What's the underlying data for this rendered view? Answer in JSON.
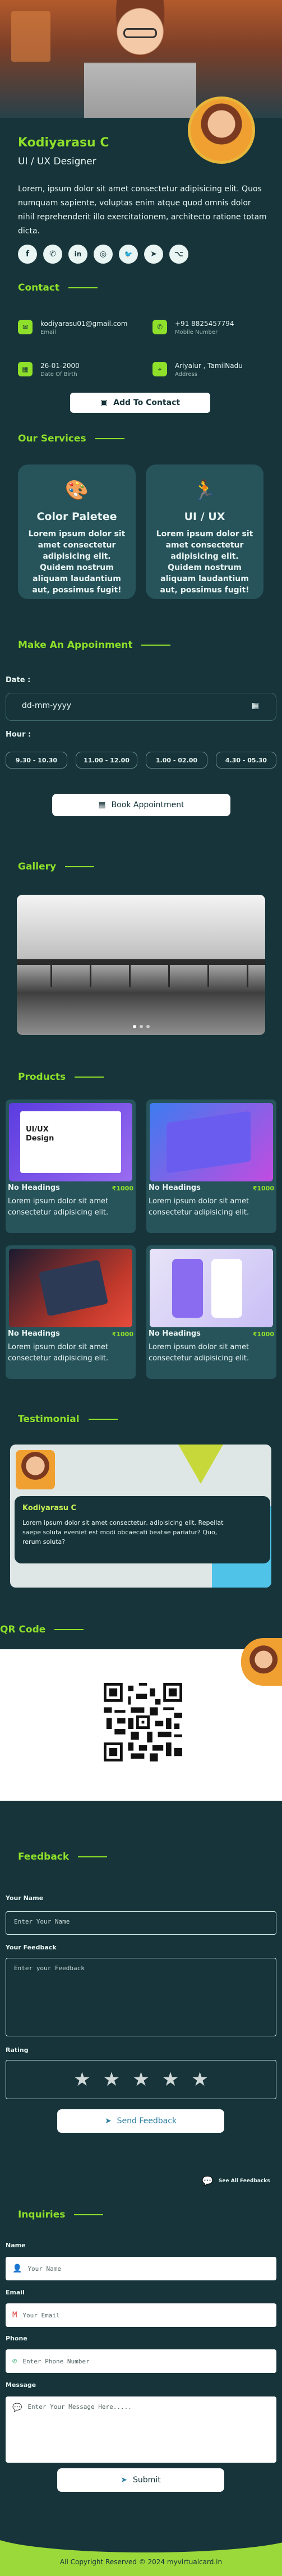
{
  "profile": {
    "name": "Kodiyarasu C",
    "role": "UI / UX Designer",
    "bio": "Lorem, ipsum dolor sit amet consectetur adipisicing elit. Quos numquam sapiente, voluptas enim atque quod omnis dolor nihil reprehenderit illo exercitationem, architecto ratione totam dicta."
  },
  "social": [
    {
      "icon": "facebook-icon",
      "glyph": "f"
    },
    {
      "icon": "whatsapp-icon",
      "glyph": "✆"
    },
    {
      "icon": "linkedin-icon",
      "glyph": "in"
    },
    {
      "icon": "instagram-icon",
      "glyph": "◎"
    },
    {
      "icon": "twitter-icon",
      "glyph": "🐦"
    },
    {
      "icon": "telegram-icon",
      "glyph": "➤"
    },
    {
      "icon": "github-icon",
      "glyph": "⌥"
    }
  ],
  "contact": {
    "title": "Contact",
    "email": {
      "value": "kodiyarasu01@gmail.com",
      "label": "Email"
    },
    "phone": {
      "value": "+91 8825457794",
      "label": "Mobile Number"
    },
    "dob": {
      "value": "26-01-2000",
      "label": "Date Of Birth"
    },
    "address": {
      "value": "Ariyalur , TamilNadu",
      "label": "Address"
    },
    "add_button": "Add To Contact"
  },
  "services": {
    "title": "Our Services",
    "items": [
      {
        "title": "Color Paletee",
        "desc": "Lorem ipsum dolor sit amet consectetur adipisicing elit. Quidem nostrum aliquam laudantium aut, possimus fugit!"
      },
      {
        "title": "UI / UX",
        "desc": "Lorem ipsum dolor sit amet consectetur adipisicing elit. Quidem nostrum aliquam laudantium aut, possimus fugit!"
      }
    ]
  },
  "appointment": {
    "title": "Make An Appoinment",
    "date_label": "Date :",
    "date_value": "dd-mm-yyyy",
    "hour_label": "Hour :",
    "slots": [
      "9.30 - 10.30",
      "11.00 - 12.00",
      "1.00 - 02.00",
      "4.30 - 05.30"
    ],
    "book_button": "Book Appointment"
  },
  "gallery": {
    "title": "Gallery"
  },
  "products": {
    "title": "Products",
    "items": [
      {
        "title": "No Headings",
        "price": "₹1000",
        "desc": "Lorem ipsum dolor sit amet consectetur adipisicing elit."
      },
      {
        "title": "No Headings",
        "price": "₹1000",
        "desc": "Lorem ipsum dolor sit amet consectetur adipisicing elit."
      },
      {
        "title": "No Headings",
        "price": "₹1000",
        "desc": "Lorem ipsum dolor sit amet consectetur adipisicing elit."
      },
      {
        "title": "No Headings",
        "price": "₹1000",
        "desc": "Lorem ipsum dolor sit amet consectetur adipisicing elit."
      }
    ],
    "thumb1_text": "UI/UX Design"
  },
  "testimonial": {
    "title": "Testimonial",
    "name": "Kodiyarasu C",
    "text": "Lorem ipsum dolor sit amet consectetur, adipisicing elit. Repellat saepe soluta eveniet est modi obcaecati beatae pariatur? Quo, rerum soluta?"
  },
  "qr": {
    "title": "QR Code"
  },
  "feedback": {
    "title": "Feedback",
    "name_label": "Your Name",
    "name_placeholder": "Enter Your Name",
    "feedback_label": "Your Feedback",
    "feedback_placeholder": "Enter your Feedback",
    "rating_label": "Rating",
    "rating": 0,
    "send_button": "Send Feedback",
    "see_all": "See All Feedbacks"
  },
  "inquiries": {
    "title": "Inquiries",
    "name_label": "Name",
    "name_placeholder": "Your Name",
    "email_label": "Email",
    "email_placeholder": "Your Email",
    "phone_label": "Phone",
    "phone_placeholder": "Enter Phone Number",
    "message_label": "Message",
    "message_placeholder": "Enter Your Message Here.....",
    "submit_button": "Submit"
  },
  "footer": {
    "copyright": "All Copyright Reserved © 2024 myvirtualcard.in"
  },
  "colors": {
    "background": "#16343a",
    "accent": "#8ee02a",
    "card": "#27535b"
  }
}
